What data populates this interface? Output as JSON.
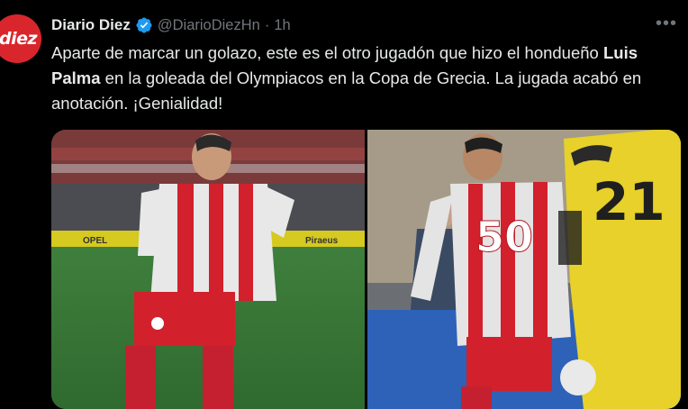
{
  "author": {
    "avatar_text": "diez",
    "display_name": "Diario Diez",
    "handle": "@DiarioDiezHn",
    "separator": "·",
    "time": "1h"
  },
  "tweet": {
    "text_part1": "Aparte de marcar un golazo, este es el otro jugadón que hizo el hondueño ",
    "text_bold": "Luis Palma",
    "text_part2": " en la goleada del Olympiacos en la Copa de Grecia. La jugada acabó en anotación. ¡Genialidad!"
  },
  "media": {
    "left_board_1": "OPEL",
    "left_board_2": "Piraeus",
    "right_jersey_player": "50",
    "right_jersey_keeper": "21"
  },
  "icons": {
    "verified": "verified-badge-icon",
    "more": "more-options-icon"
  },
  "colors": {
    "background": "#000000",
    "text": "#e7e9ea",
    "muted": "#71767b",
    "verified": "#1d9bf0",
    "avatar": "#d9262c"
  }
}
